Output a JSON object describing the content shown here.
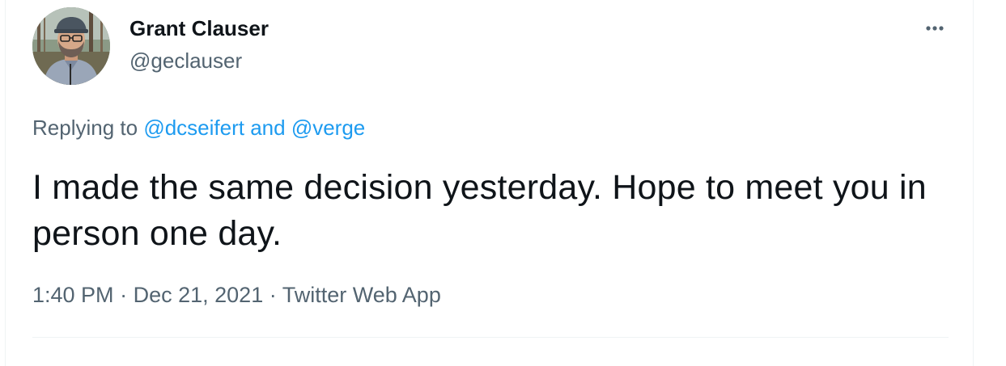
{
  "author": {
    "name": "Grant Clauser",
    "handle": "@geclauser"
  },
  "reply": {
    "prefix": "Replying to",
    "mention1": "@dcseifert",
    "joiner": "and",
    "mention2": "@verge"
  },
  "tweet": {
    "text": "I made the same decision yesterday. Hope to meet you in person one day."
  },
  "meta": {
    "time": "1:40 PM",
    "sep1": "·",
    "date": "Dec 21, 2021",
    "sep2": "·",
    "source": "Twitter Web App"
  },
  "icons": {
    "more": "more-horizontal-icon"
  },
  "colors": {
    "text": "#0f1419",
    "secondary": "#536471",
    "link": "#1d9bf0",
    "divider": "#eff3f4"
  }
}
